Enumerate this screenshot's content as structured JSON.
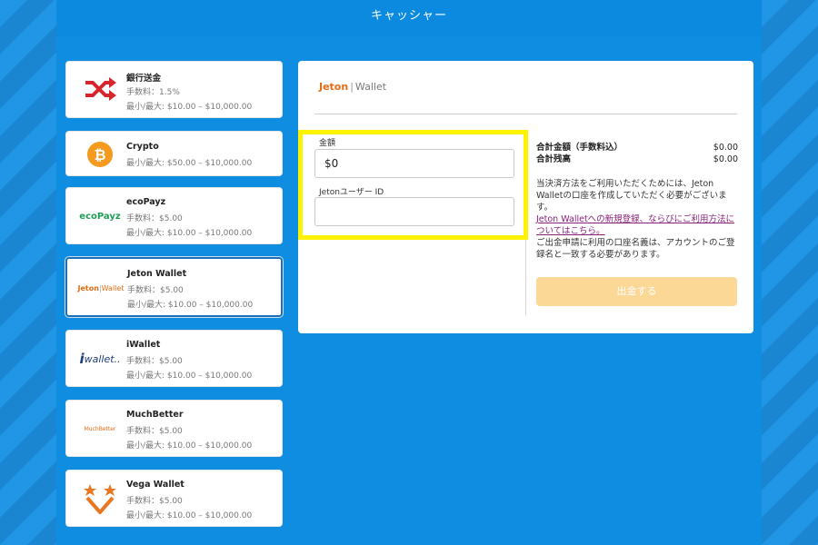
{
  "header": {
    "title": "キャッシャー"
  },
  "methods": [
    {
      "name": "銀行送金",
      "fee": "手数料：1.5%",
      "limits": "最小/最大: $10.00 – $10,000.00",
      "icon": "shuffle-icon"
    },
    {
      "name": "Crypto",
      "fee": "",
      "limits": "最小/最大: $50.00 – $10,000.00",
      "icon": "bitcoin-icon"
    },
    {
      "name": "ecoPayz",
      "fee": "手数料：$5.00",
      "limits": "最小/最大: $10.00 – $10,000.00",
      "logo": "ecoPayz"
    },
    {
      "name": "Jeton Wallet",
      "fee": "手数料：$5.00",
      "limits": "最小/最大: $10.00 – $10,000.00",
      "logo_a": "Jeton",
      "logo_b": "Wallet"
    },
    {
      "name": "iWallet",
      "fee": "手数料：$5.00",
      "limits": "最小/最大: $10.00 – $10,000.00",
      "logo_a": "i",
      "logo_b": "wallet.."
    },
    {
      "name": "MuchBetter",
      "fee": "手数料：$5.00",
      "limits": "最小/最大: $10.00 – $10,000.00",
      "logo": "MuchBetter"
    },
    {
      "name": "Vega Wallet",
      "fee": "手数料：$5.00",
      "limits": "最小/最大: $10.00 – $10,000.00",
      "icon": "vega-stars-icon"
    }
  ],
  "panel": {
    "brand_a": "Jeton",
    "brand_b": "Wallet",
    "amount_label": "金額",
    "amount_value": "$0",
    "userid_label": "Jetonユーザー ID",
    "userid_value": "",
    "total_label": "合計金額（手数料込）",
    "total_value": "$0.00",
    "balance_label": "合計残高",
    "balance_value": "$0.00",
    "info_text": "当決済方法をご利用いただくためには、Jeton Walletの口座を作成していただく必要がございます。",
    "info_link": "Jeton Walletへの新規登録、ならびにご利用方法についてはこちら。",
    "info_note": "ご出金申請に利用の口座名義は、アカウントのご登録名と一致する必要があります。",
    "withdraw_label": "出金する"
  },
  "colors": {
    "accent": "#0f8de0",
    "jeton_orange": "#e46b12",
    "highlight": "#fff200",
    "button_disabled": "#fbd895",
    "link": "#8a1f7a"
  }
}
